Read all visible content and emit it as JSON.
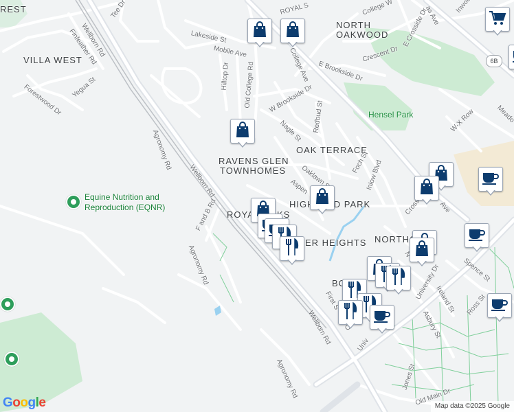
{
  "colors": {
    "background": "#f1f3f4",
    "road": "#ffffff",
    "major_road": "#dfe3e8",
    "park_green": "#cdebd3",
    "campus": "#f3ead5",
    "marker_icon": "#0d3c6e",
    "water": "#9ad1f0"
  },
  "areas": {
    "villa_west_top": "REST",
    "villa_west": "VILLA WEST",
    "north_oakwood_1": "NORTH",
    "north_oakwood_2": "OAKWOOD",
    "oak_terrace": "OAK TERRACE",
    "ravens_glen_1": "RAVENS GLEN",
    "ravens_glen_2": "TOWNHOMES",
    "highland_park": "HIGHLAND PARK",
    "royal_oaks": "ROYAL OAKS",
    "heights": "ER HEIGHTS",
    "northgate": "NORTHG",
    "bo": "BO"
  },
  "parks": {
    "hensel": "Hensel Park"
  },
  "poi": {
    "eqnr_1": "Equine Nutrition and",
    "eqnr_2": "Reproduction (EQNR)"
  },
  "streets": {
    "wellborn_top": "Wellborn Rd",
    "wellborn_mid": "Wellborn Rd",
    "wellborn_bottom": "Wellborn Rd",
    "finfeather": "Finfeather Rd",
    "tee": "Tee Dr",
    "forestwood": "Forestwood Dr",
    "yegua": "Yegua St",
    "agronomy_1": "Agronomy Rd",
    "agronomy_2": "Agronomy Rd",
    "agronomy_3": "Agronomy Rd",
    "f_and_b": "F and B Rd",
    "lakeside": "Lakeside St",
    "mobile": "Mobile Ave",
    "hilltop": "Hilltop Dr",
    "old_college": "Old College Rd",
    "college_ave": "College Ave",
    "college_w": "College W",
    "royal": "ROYAL S",
    "e_brookside": "E Brookside Dr",
    "w_brookside": "W Brookside Dr",
    "crescent": "Crescent Dr",
    "e_crosside": "E Crosside Dr",
    "inwood": "Inwoo",
    "redbud": "Redbud St",
    "nagle": "Nagle St",
    "oaklawn": "Oaklawn S",
    "aspen": "Aspen",
    "foch": "Foch St",
    "inlow": "Inlow Blvd",
    "wx_row": "W-X Row",
    "meadow": "Meado",
    "cross": "Cross",
    "ave_s": "Ave",
    "university_dr": "University Dr",
    "university_low": "Univ",
    "spence": "Spence St",
    "ireland": "Ireland St",
    "asbury": "Asbury St",
    "ross": "Ross St",
    "first": "First S",
    "ch": "Ch",
    "jones": "Jones St",
    "old_main": "Old Main Dr",
    "as_ave": "as Ave",
    "n": "N"
  },
  "highway_shield": "6B",
  "markers": [
    {
      "type": "shopping-bag"
    },
    {
      "type": "shopping-bag"
    },
    {
      "type": "shopping-cart"
    },
    {
      "type": "shopping-bag"
    },
    {
      "type": "shopping-bag"
    },
    {
      "type": "shopping-bag"
    },
    {
      "type": "coffee-cup"
    },
    {
      "type": "shopping-bag"
    },
    {
      "type": "shopping-bag"
    },
    {
      "type": "coffee-cup"
    },
    {
      "type": "coffee-cup"
    },
    {
      "type": "restaurant"
    },
    {
      "type": "restaurant"
    },
    {
      "type": "shopping-bag"
    },
    {
      "type": "shopping-bag"
    },
    {
      "type": "coffee-cup"
    },
    {
      "type": "shopping-bag"
    },
    {
      "type": "restaurant"
    },
    {
      "type": "restaurant"
    },
    {
      "type": "restaurant"
    },
    {
      "type": "restaurant"
    },
    {
      "type": "restaurant"
    },
    {
      "type": "coffee-cup"
    },
    {
      "type": "coffee-cup"
    },
    {
      "type": "coffee-cup"
    }
  ],
  "branding": {
    "logo": "Google"
  },
  "attribution": "Map data ©2025 Google"
}
